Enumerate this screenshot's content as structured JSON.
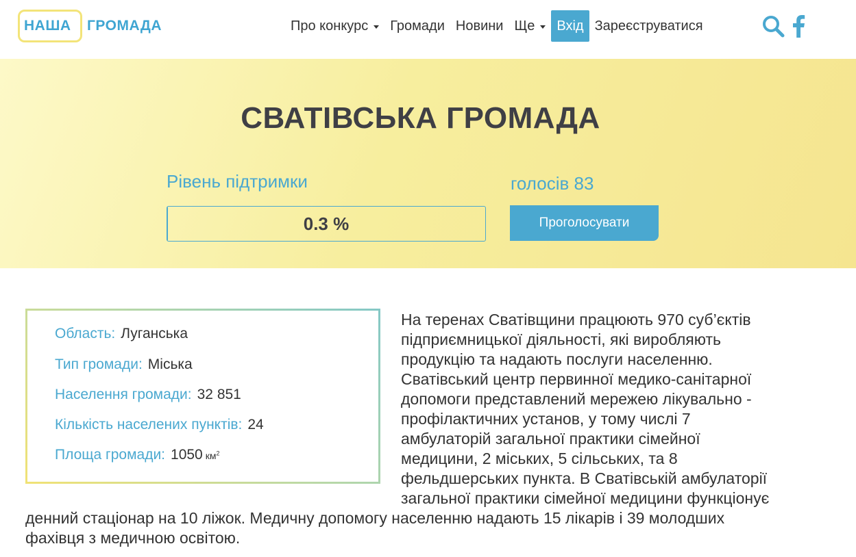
{
  "logo": {
    "word1": "НАША",
    "word2": "ГРОМАДА"
  },
  "nav": {
    "about": "Про конкурс",
    "communities": "Громади",
    "news": "Новини",
    "more": "Ще",
    "login": "Вхід",
    "register": "Зареєструватися"
  },
  "icons": {
    "search": "search-icon",
    "facebook": "facebook-icon"
  },
  "colors": {
    "accent": "#4aa8d0",
    "hero_yellow": "#f7ee9e",
    "title": "#3f3f45"
  },
  "hero": {
    "title": "СВАТІВСЬКА ГРОМАДА",
    "support_label": "Рівень підтримки",
    "votes_label": "голосів 83",
    "progress_text": "0.3 %",
    "progress_value": 0.3,
    "vote_button": "Проголосувати"
  },
  "info": {
    "region_label": "Область:",
    "region_value": "Луганська",
    "type_label": "Тип громади:",
    "type_value": "Міська",
    "population_label": "Населення громади:",
    "population_value": "32 851",
    "settlements_label": "Кількість населених пунктів:",
    "settlements_value": "24",
    "area_label": "Площа громади:",
    "area_value": "1050",
    "area_unit": "км",
    "area_unit_sup": "2"
  },
  "description": {
    "lines_top": [
      "На теренах Сватівщини працюють 970 суб’єктів",
      "підприємницької діяльності, які виробляють",
      "продукцію та надають послуги населенню.",
      "Сватівський центр первинної медико-санітарної",
      "допомоги представлений мережею лікувально -",
      "профілактичних установ, у тому числі 7",
      "амбулаторій загальної практики сімейної",
      "медицини, 2 міських, 5 сільських, та 8",
      "фельдшерських пункта. В Сватівській амбулаторії",
      "загальної практики сімейної медицини функціонує"
    ],
    "lines_bottom": [
      "денний стаціонар на 10 ліжок. Медичну допомогу населенню надають 15 лікарів і 39 молодших",
      "фахівця з медичною освітою."
    ]
  }
}
